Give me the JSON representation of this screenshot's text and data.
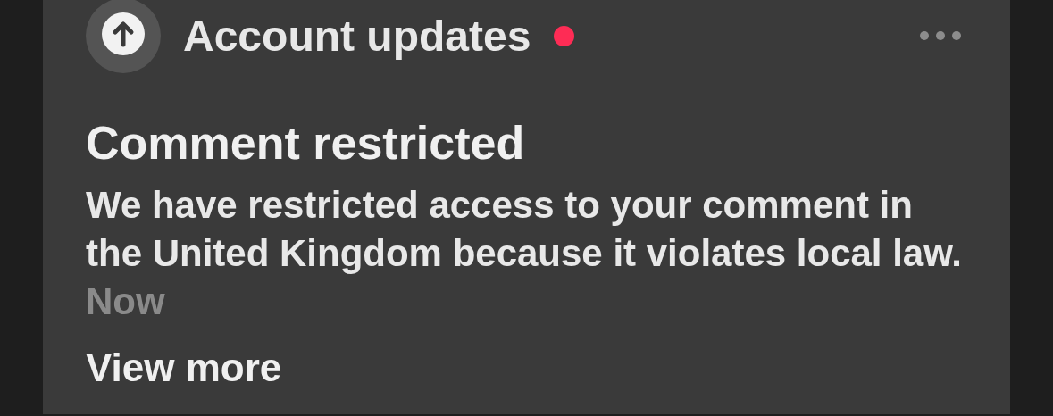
{
  "notification": {
    "category": "Account updates",
    "unread": true,
    "title": "Comment restricted",
    "body": "We have restricted access to your comment in the United Kingdom because it violates local law.",
    "time": "Now",
    "action": "View more"
  }
}
